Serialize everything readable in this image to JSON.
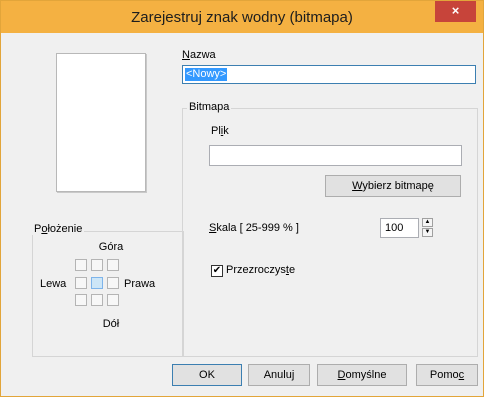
{
  "window": {
    "title": "Zarejestruj znak wodny (bitmapa)",
    "close_glyph": "×",
    "accent_color": "#f4b142",
    "close_color": "#c7443a"
  },
  "position": {
    "label_prefix": "P",
    "label_u": "o",
    "label_rest": "łożenie",
    "top": "Góra",
    "left": "Lewa",
    "right": "Prawa",
    "bottom": "Dół",
    "selected_cell": "center"
  },
  "name": {
    "label_u": "N",
    "label_rest": "azwa",
    "value": "<Nowy>"
  },
  "bitmap": {
    "group_label": "Bitmapa",
    "file_label_pre": "Pl",
    "file_label_u": "i",
    "file_label_post": "k",
    "file_value": "",
    "choose_button_u": "W",
    "choose_button_rest": "ybierz bitmapę",
    "scale_label_u": "S",
    "scale_label_rest": "kala  [ 25-999 % ]",
    "scale_value": "100",
    "transparent_label_pre": "Przezroczys",
    "transparent_label_u": "t",
    "transparent_label_post": "e",
    "transparent_checked": true
  },
  "buttons": {
    "ok": "OK",
    "cancel": "Anuluj",
    "defaults_u": "D",
    "defaults_rest": "omyślne",
    "help_pre": "Pomo",
    "help_u": "c"
  }
}
